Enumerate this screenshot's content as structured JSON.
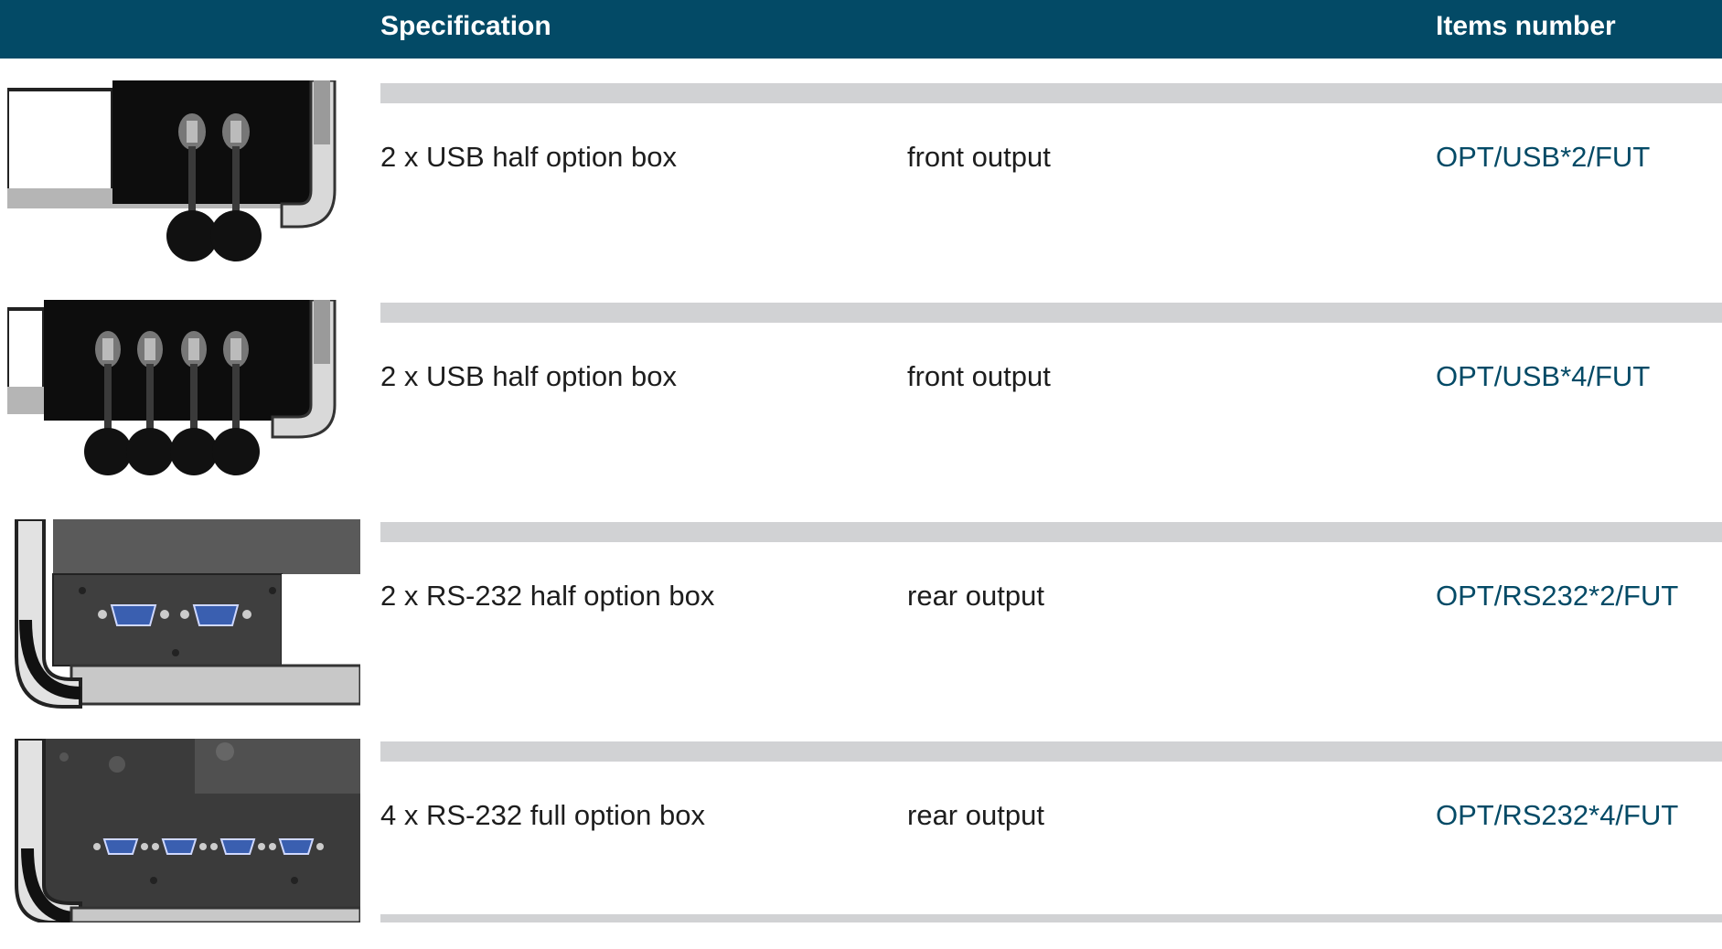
{
  "header": {
    "specification_label": "Specification",
    "items_number_label": "Items number"
  },
  "colors": {
    "header_bg": "#034a66",
    "item_number_text": "#034a66",
    "divider_bar": "#d1d2d4"
  },
  "rows": [
    {
      "image_icon": "usb-2-port-box-image",
      "specification": "2 x USB half option box",
      "output": "front output",
      "item_number": "OPT/USB*2/FUT"
    },
    {
      "image_icon": "usb-4-port-box-image",
      "specification": "2 x USB half option box",
      "output": "front output",
      "item_number": "OPT/USB*4/FUT"
    },
    {
      "image_icon": "rs232-2-port-box-image",
      "specification": "2 x RS-232 half option box",
      "output": "rear output",
      "item_number": "OPT/RS232*2/FUT"
    },
    {
      "image_icon": "rs232-4-port-box-image",
      "specification": "4 x RS-232 full option box",
      "output": "rear output",
      "item_number": "OPT/RS232*4/FUT"
    }
  ]
}
